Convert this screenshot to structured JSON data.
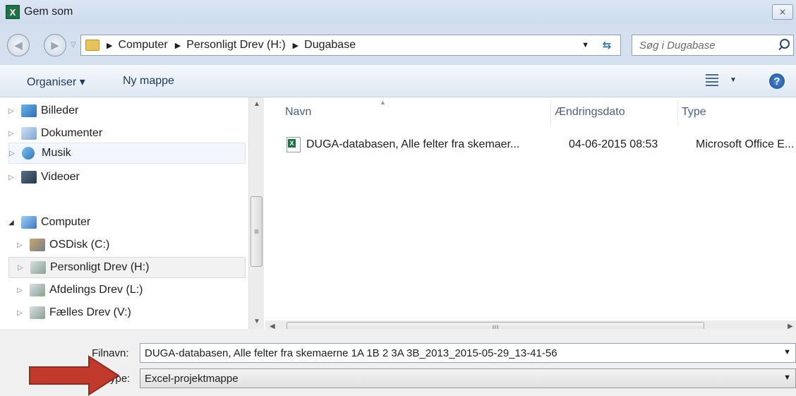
{
  "window": {
    "title": "Gem som",
    "close_label": "⨯"
  },
  "address": {
    "crumbs": [
      "Computer",
      "Personligt Drev (H:)",
      "Dugabase"
    ],
    "search_placeholder": "Søg i Dugabase"
  },
  "toolbar": {
    "organize_label": "Organiser ▾",
    "new_folder_label": "Ny mappe"
  },
  "nav": {
    "items": [
      {
        "label": "Billeder",
        "icon": "pictures-icon"
      },
      {
        "label": "Dokumenter",
        "icon": "documents-icon"
      },
      {
        "label": "Musik",
        "icon": "music-icon"
      },
      {
        "label": "Videoer",
        "icon": "videos-icon"
      },
      {
        "label": "Computer",
        "icon": "computer-icon"
      },
      {
        "label": "OSDisk (C:)",
        "icon": "disk-icon"
      },
      {
        "label": "Personligt Drev (H:)",
        "icon": "network-drive-icon"
      },
      {
        "label": "Afdelings Drev (L:)",
        "icon": "network-drive-icon"
      },
      {
        "label": "Fælles Drev (V:)",
        "icon": "network-drive-icon"
      }
    ]
  },
  "filelist": {
    "columns": [
      "Navn",
      "Ændringsdato",
      "Type"
    ],
    "rows": [
      {
        "name": "DUGA-databasen, Alle felter fra skemaer...",
        "date": "04-06-2015 08:53",
        "type": "Microsoft Office E..."
      }
    ]
  },
  "save": {
    "filename_label": "Filnavn:",
    "filename_value": "DUGA-databasen, Alle felter fra skemaerne 1A 1B 2 3A 3B_2013_2015-05-29_13-41-56",
    "filetype_label": "Filtype:",
    "filetype_value": "Excel-projektmappe"
  },
  "colors": {
    "accent": "#c0392b",
    "titlebar": "#d5e0ee"
  }
}
